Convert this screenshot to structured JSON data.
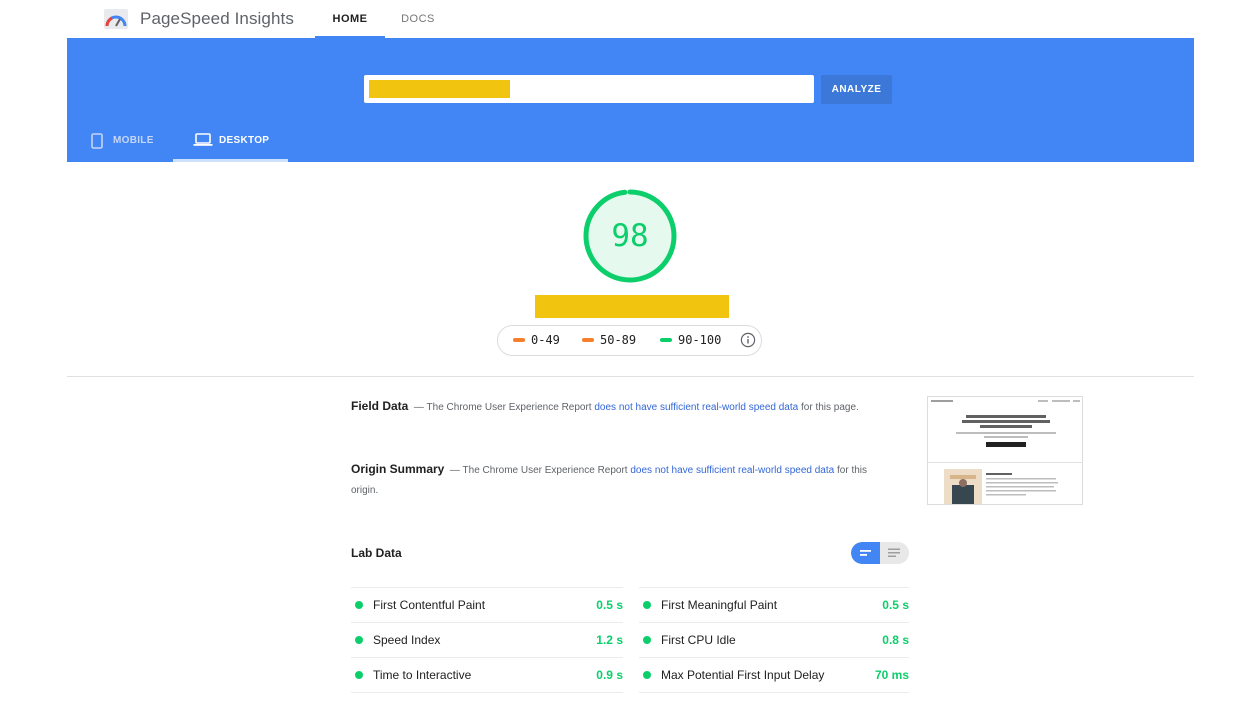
{
  "app": {
    "brand": "PageSpeed Insights",
    "nav": [
      {
        "label": "HOME",
        "active": true
      },
      {
        "label": "DOCS",
        "active": false
      }
    ]
  },
  "header": {
    "url_value": "",
    "analyze_label": "ANALYZE",
    "devices": [
      {
        "label": "MOBILE",
        "icon": "phone-icon",
        "active": false
      },
      {
        "label": "DESKTOP",
        "icon": "laptop-icon",
        "active": true
      }
    ],
    "band_color": "#4285f4"
  },
  "score": {
    "value": "98",
    "fraction": 0.98,
    "color": "#0cce6b",
    "legend": [
      {
        "label": "0-49",
        "color": "#f57f2a"
      },
      {
        "label": "50-89",
        "color": "#f57f2a"
      },
      {
        "label": "90-100",
        "color": "#0cce6b"
      }
    ]
  },
  "field_data": {
    "title": "Field Data",
    "prefix": "— The Chrome User Experience Report",
    "link": "does not have sufficient real-world speed data",
    "suffix": "for this page."
  },
  "origin_summary": {
    "title": "Origin Summary",
    "prefix": "— The Chrome User Experience Report",
    "link": "does not have sufficient real-world speed data",
    "suffix": "for this origin."
  },
  "lab_data": {
    "title": "Lab Data",
    "metrics_left": [
      {
        "name": "First Contentful Paint",
        "value": "0.5 s"
      },
      {
        "name": "Speed Index",
        "value": "1.2 s"
      },
      {
        "name": "Time to Interactive",
        "value": "0.9 s"
      }
    ],
    "metrics_right": [
      {
        "name": "First Meaningful Paint",
        "value": "0.5 s"
      },
      {
        "name": "First CPU Idle",
        "value": "0.8 s"
      },
      {
        "name": "Max Potential First Input Delay",
        "value": "70 ms"
      }
    ]
  }
}
